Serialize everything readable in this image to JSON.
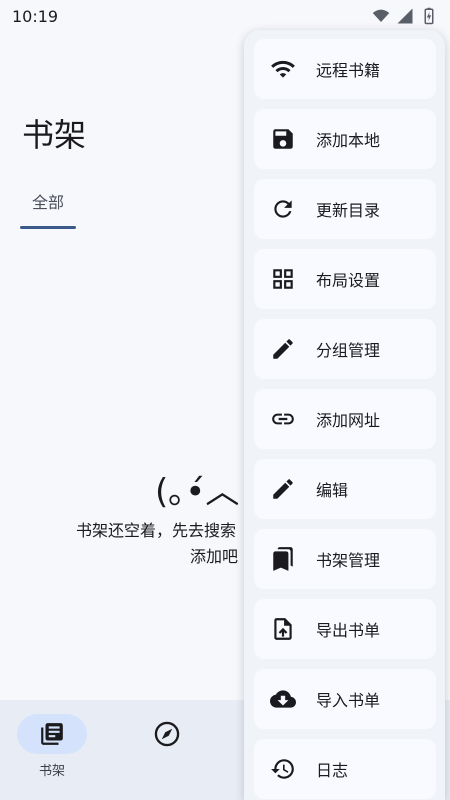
{
  "status_bar": {
    "time": "10:19",
    "icons": [
      "wifi-icon",
      "signal-icon",
      "battery-icon"
    ]
  },
  "page": {
    "title": "书架"
  },
  "tabs": [
    {
      "label": "全部",
      "selected": true
    }
  ],
  "empty_state": {
    "face": "(｡•́︿•̀｡)",
    "line1": "书架还空着，先去搜索",
    "line2": "添加吧"
  },
  "bottom_nav": {
    "items": [
      {
        "label": "书架",
        "icon": "library-icon",
        "active": true
      },
      {
        "label": "",
        "icon": "compass-icon",
        "active": false
      }
    ]
  },
  "menu": {
    "items": [
      {
        "label": "远程书籍",
        "icon": "wifi-icon"
      },
      {
        "label": "添加本地",
        "icon": "save-icon"
      },
      {
        "label": "更新目录",
        "icon": "refresh-icon"
      },
      {
        "label": "布局设置",
        "icon": "grid-icon"
      },
      {
        "label": "分组管理",
        "icon": "pencil-icon"
      },
      {
        "label": "添加网址",
        "icon": "link-icon"
      },
      {
        "label": "编辑",
        "icon": "pencil-icon"
      },
      {
        "label": "书架管理",
        "icon": "bookmarks-icon"
      },
      {
        "label": "导出书单",
        "icon": "file-upload-icon"
      },
      {
        "label": "导入书单",
        "icon": "cloud-download-icon"
      },
      {
        "label": "日志",
        "icon": "history-icon"
      }
    ]
  },
  "colors": {
    "accent": "#3b5a8a",
    "nav_active_bg": "#d4e3fb",
    "background": "#f7f8fc"
  }
}
